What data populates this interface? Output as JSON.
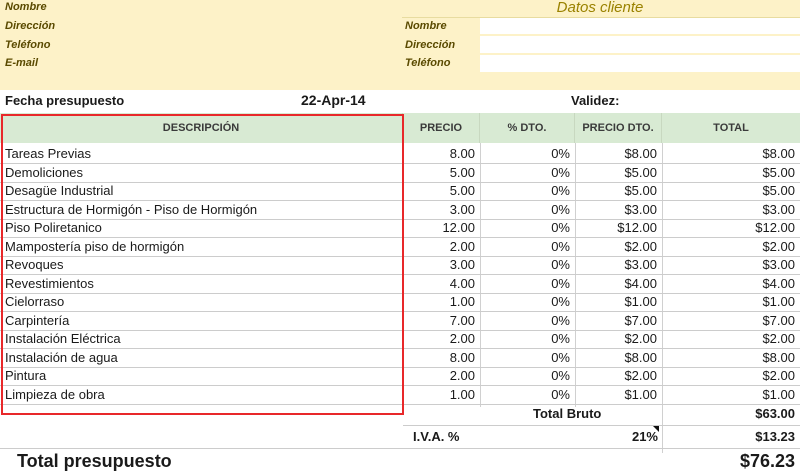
{
  "company": {
    "labels": [
      "Nombre",
      "Dirección",
      "Teléfono",
      "E-mail"
    ]
  },
  "client": {
    "title": "Datos cliente",
    "labels": [
      "Nombre",
      "Dirección",
      "Teléfono"
    ]
  },
  "meta": {
    "fecha_label": "Fecha presupuesto",
    "fecha_value": "22-Apr-14",
    "validez_label": "Validez:"
  },
  "table": {
    "headers": [
      "DESCRIPCIÓN",
      "PRECIO",
      "% DTO.",
      "PRECIO DTO.",
      "TOTAL"
    ],
    "rows": [
      {
        "desc": "Tareas Previas",
        "precio": "8.00",
        "dto": "0%",
        "precio_dto": "$8.00",
        "total": "$8.00"
      },
      {
        "desc": "Demoliciones",
        "precio": "5.00",
        "dto": "0%",
        "precio_dto": "$5.00",
        "total": "$5.00"
      },
      {
        "desc": "Desagüe Industrial",
        "precio": "5.00",
        "dto": "0%",
        "precio_dto": "$5.00",
        "total": "$5.00"
      },
      {
        "desc": "Estructura de Hormigón - Piso de Hormigón",
        "precio": "3.00",
        "dto": "0%",
        "precio_dto": "$3.00",
        "total": "$3.00"
      },
      {
        "desc": "Piso Poliretanico",
        "precio": "12.00",
        "dto": "0%",
        "precio_dto": "$12.00",
        "total": "$12.00"
      },
      {
        "desc": "Mampostería piso de hormigón",
        "precio": "2.00",
        "dto": "0%",
        "precio_dto": "$2.00",
        "total": "$2.00"
      },
      {
        "desc": "Revoques",
        "precio": "3.00",
        "dto": "0%",
        "precio_dto": "$3.00",
        "total": "$3.00"
      },
      {
        "desc": "Revestimientos",
        "precio": "4.00",
        "dto": "0%",
        "precio_dto": "$4.00",
        "total": "$4.00"
      },
      {
        "desc": "Cielorraso",
        "precio": "1.00",
        "dto": "0%",
        "precio_dto": "$1.00",
        "total": "$1.00"
      },
      {
        "desc": "Carpintería",
        "precio": "7.00",
        "dto": "0%",
        "precio_dto": "$7.00",
        "total": "$7.00"
      },
      {
        "desc": "Instalación Eléctrica",
        "precio": "2.00",
        "dto": "0%",
        "precio_dto": "$2.00",
        "total": "$2.00"
      },
      {
        "desc": "Instalación de agua",
        "precio": "8.00",
        "dto": "0%",
        "precio_dto": "$8.00",
        "total": "$8.00"
      },
      {
        "desc": "Pintura",
        "precio": "2.00",
        "dto": "0%",
        "precio_dto": "$2.00",
        "total": "$2.00"
      },
      {
        "desc": "Limpieza de obra",
        "precio": "1.00",
        "dto": "0%",
        "precio_dto": "$1.00",
        "total": "$1.00"
      }
    ]
  },
  "totals": {
    "bruto_label": "Total Bruto",
    "bruto_value": "$63.00",
    "iva_label": "I.V.A. %",
    "iva_pct": "21%",
    "iva_value": "$13.23",
    "total_label": "Total presupuesto",
    "total_value": "$76.23"
  },
  "colors": {
    "header_band": "#fdf2c8",
    "table_header": "#d8ead3",
    "highlight_border": "#e8282a",
    "client_title": "#9a8200"
  }
}
